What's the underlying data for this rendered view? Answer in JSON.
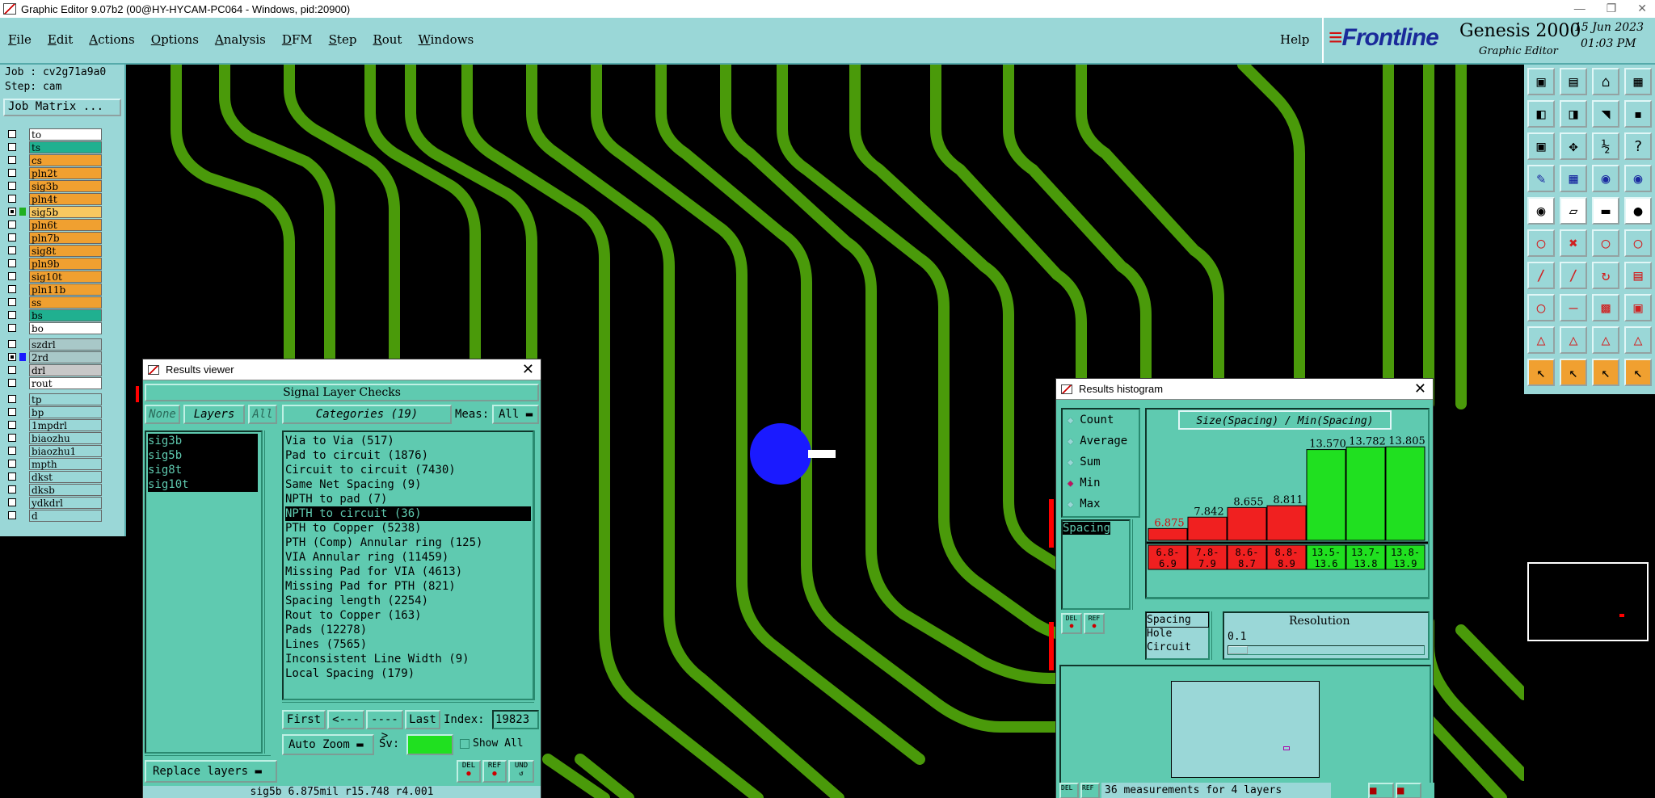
{
  "window": {
    "title": "Graphic Editor 9.07b2 (00@HY-HYCAM-PC064 - Windows, pid:20900)"
  },
  "menu": {
    "items": [
      "File",
      "Edit",
      "Actions",
      "Options",
      "Analysis",
      "DFM",
      "Step",
      "Rout",
      "Windows"
    ],
    "help": "Help"
  },
  "brand": {
    "logo": "Frontline",
    "product": "Genesis 2000",
    "subtitle": "Graphic Editor",
    "date": "15 Jun 2023",
    "time": "01:03 PM"
  },
  "job": {
    "job": "Job : cv2g71a9a0",
    "step": "Step: cam",
    "matrix_button": "Job Matrix ..."
  },
  "layers": {
    "group1": [
      {
        "name": "to",
        "color": "#ffffff"
      },
      {
        "name": "ts",
        "color": "#20b090"
      },
      {
        "name": "cs",
        "color": "#f0a030"
      },
      {
        "name": "pln2t",
        "color": "#f0a030"
      },
      {
        "name": "sig3b",
        "color": "#f0a030"
      },
      {
        "name": "pln4t",
        "color": "#f0a030"
      },
      {
        "name": "sig5b",
        "color": "#f8c860",
        "active": true
      },
      {
        "name": "pln6t",
        "color": "#f0a030"
      },
      {
        "name": "pln7b",
        "color": "#f0a030"
      },
      {
        "name": "sig8t",
        "color": "#f0a030"
      },
      {
        "name": "pln9b",
        "color": "#f0a030"
      },
      {
        "name": "sig10t",
        "color": "#f0a030"
      },
      {
        "name": "pln11b",
        "color": "#f0a030"
      },
      {
        "name": "ss",
        "color": "#f0a030"
      },
      {
        "name": "bs",
        "color": "#20b090"
      },
      {
        "name": "bo",
        "color": "#ffffff"
      }
    ],
    "group2": [
      {
        "name": "szdrl",
        "color": "#a8c8c8"
      },
      {
        "name": "2rd",
        "color": "#a8c8c8",
        "active": true
      },
      {
        "name": "drl",
        "color": "#c8c8c8"
      },
      {
        "name": "rout",
        "color": "#ffffff"
      }
    ],
    "group3": [
      {
        "name": "tp",
        "color": "#9ad7d7"
      },
      {
        "name": "bp",
        "color": "#9ad7d7"
      },
      {
        "name": "1mpdrl",
        "color": "#9ad7d7"
      },
      {
        "name": "biaozhu",
        "color": "#9ad7d7"
      },
      {
        "name": "biaozhu1",
        "color": "#9ad7d7"
      },
      {
        "name": "mpth",
        "color": "#9ad7d7"
      },
      {
        "name": "dkst",
        "color": "#9ad7d7"
      },
      {
        "name": "dksb",
        "color": "#9ad7d7"
      },
      {
        "name": "ydkdrl",
        "color": "#9ad7d7"
      },
      {
        "name": "d",
        "color": "#9ad7d7"
      }
    ]
  },
  "results_viewer": {
    "title": "Results viewer",
    "section": "Signal Layer Checks",
    "none_btn": "None",
    "layers_btn": "Layers",
    "all_btn": "All",
    "categories_label": "Categories (19)",
    "meas_label": "Meas:",
    "meas_value": "All",
    "layer_items": [
      "sig3b",
      "sig5b",
      "sig8t",
      "sig10t"
    ],
    "categories": [
      "Via to Via (517)",
      "Pad to circuit (1876)",
      "Circuit to circuit (7430)",
      "Same Net Spacing (9)",
      "NPTH to pad (7)",
      "NPTH to circuit (36)",
      "PTH to Copper (5238)",
      "PTH (Comp) Annular ring (125)",
      "VIA Annular ring (11459)",
      "Missing Pad for VIA (4613)",
      "Missing Pad for PTH (821)",
      "Spacing length (2254)",
      "Rout to Copper (163)",
      "Pads (12278)",
      "Lines (7565)",
      "Inconsistent Line Width (9)",
      "Local Spacing (179)"
    ],
    "selected_index": 5,
    "first_btn": "First",
    "prev_btn": "<----",
    "next_btn": "---->",
    "last_btn": "Last",
    "index_label": "Index:",
    "index_value": "19823",
    "autozoom_label": "Auto Zoom",
    "sv_label": "Sv:",
    "showall_label": "Show All",
    "replace_label": "Replace layers",
    "del_label": "DEL",
    "ref_label": "REF",
    "und_label": "UND",
    "status": "sig5b 6.875mil r15.748 r4.001"
  },
  "histogram": {
    "title": "Results histogram",
    "options": [
      "Count",
      "Average",
      "Sum",
      "Min",
      "Max"
    ],
    "selected_option": "Min",
    "list_item": "Spacing",
    "chart_title": "Size(Spacing) / Min(Spacing)",
    "types": [
      "Spacing",
      "Hole",
      "Circuit"
    ],
    "resolution_label": "Resolution",
    "resolution_value": "0.1",
    "del_label": "DEL",
    "ref_label": "REF",
    "status": "36 measurements for 4 layers",
    "colors": {
      "fail": "#f02020",
      "pass": "#20e020"
    },
    "chart_data": {
      "type": "bar",
      "categories": [
        "6.8-6.9",
        "7.8-7.9",
        "8.6-8.7",
        "8.8-8.9",
        "13.5-13.6",
        "13.7-13.8",
        "13.8-13.9"
      ],
      "values": [
        6.875,
        7.842,
        8.655,
        8.811,
        13.57,
        13.782,
        13.805
      ],
      "labels": [
        "6.875",
        "7.842",
        "8.655",
        "8.811",
        "13.570",
        "13.782",
        "13.805"
      ],
      "status": [
        "fail",
        "fail",
        "fail",
        "fail",
        "pass",
        "pass",
        "pass"
      ],
      "title": "Size(Spacing) / Min(Spacing)",
      "ylim": [
        0,
        14.5
      ]
    }
  }
}
